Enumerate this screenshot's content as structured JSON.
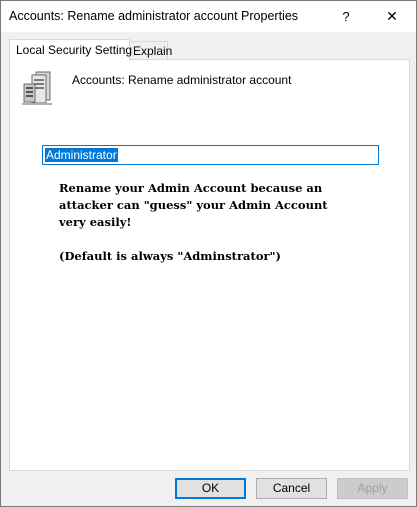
{
  "window": {
    "title": "Accounts: Rename administrator account Properties",
    "help_symbol": "?",
    "close_symbol": "✕"
  },
  "tabs": [
    {
      "label": "Local Security Setting",
      "active": true
    },
    {
      "label": "Explain",
      "active": false
    }
  ],
  "setting": {
    "icon": "server-icon",
    "name": "Accounts: Rename administrator account",
    "value": "Administrator"
  },
  "note": {
    "line1": "Rename your Admin Account because an",
    "line2": "attacker can \"guess\" your Admin Account",
    "line3": "very easily!",
    "line4": "(Default is always \"Adminstrator\")"
  },
  "buttons": {
    "ok": "OK",
    "cancel": "Cancel",
    "apply": "Apply"
  },
  "colors": {
    "accent": "#0078d7",
    "dialog_bg": "#f0f0f0",
    "panel_bg": "#ffffff"
  }
}
